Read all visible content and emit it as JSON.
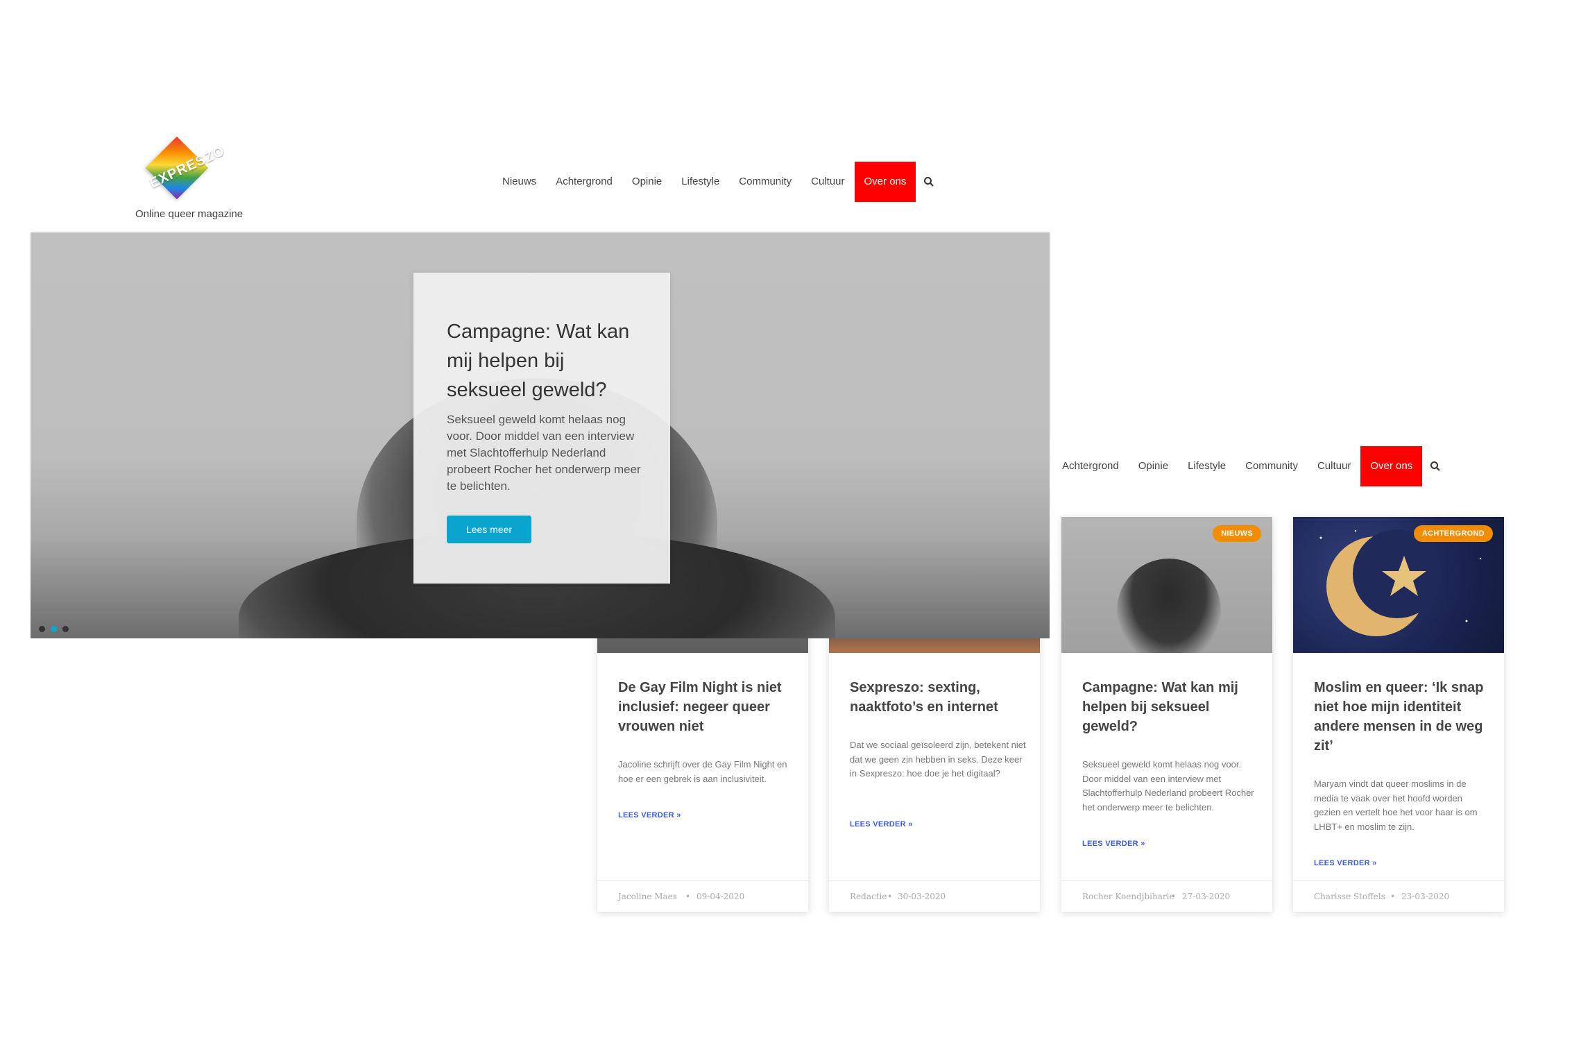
{
  "header": {
    "logo_text": "EXPRESZO",
    "tagline": "Online queer magazine",
    "nav": [
      "Nieuws",
      "Achtergrond",
      "Opinie",
      "Lifestyle",
      "Community",
      "Cultuur",
      "Over ons"
    ]
  },
  "header2": {
    "nav": [
      "Achtergrond",
      "Opinie",
      "Lifestyle",
      "Community",
      "Cultuur",
      "Over ons"
    ]
  },
  "hero": {
    "title": "Campagne: Wat kan mij helpen bij seksueel geweld?",
    "text": "Seksueel geweld komt helaas nog voor. Door middel van een interview met Slachtofferhulp Nederland probeert Rocher het onderwerp meer te belichten.",
    "button": "Lees meer",
    "active_slide": 2,
    "slide_count": 3
  },
  "colors": {
    "active_nav": "#ff0000",
    "button": "#0aa5cf",
    "badge": "#f28c00",
    "read_more": "#3d5bdb"
  },
  "cards": [
    {
      "badge": "",
      "title": "De Gay Film Night is niet inclusief: negeer queer vrouwen niet",
      "excerpt": "Jacoline schrijft over de Gay Film Night en hoe er een gebrek is aan inclusiviteit.",
      "more": "LEES VERDER »",
      "author": "Jacoline Maes",
      "date": "09-04-2020"
    },
    {
      "badge": "",
      "title": "Sexpreszo: sexting, naaktfoto’s en internet",
      "excerpt": "Dat we sociaal geïsoleerd zijn, betekent niet dat we geen zin hebben in seks. Deze keer in Sexpreszo: hoe doe je het digitaal?",
      "more": "LEES VERDER »",
      "author": "Redactie",
      "date": "30-03-2020"
    },
    {
      "badge": "NIEUWS",
      "title": "Campagne: Wat kan mij helpen bij seksueel geweld?",
      "excerpt": "Seksueel geweld komt helaas nog voor. Door middel van een interview met Slachtofferhulp Nederland probeert Rocher het onderwerp meer te belichten.",
      "more": "LEES VERDER »",
      "author": "Rocher Koendjbiharie",
      "date": "27-03-2020"
    },
    {
      "badge": "ACHTERGROND",
      "title": "Moslim en queer: ‘Ik snap niet hoe mijn identiteit andere mensen in de weg zit’",
      "excerpt": "Maryam vindt dat queer moslims in de media te vaak over het hoofd worden gezien en vertelt hoe het voor haar is om LHBT+ en moslim te zijn.",
      "more": "LEES VERDER »",
      "author": "Charisse Stoffels",
      "date": "23-03-2020"
    }
  ]
}
